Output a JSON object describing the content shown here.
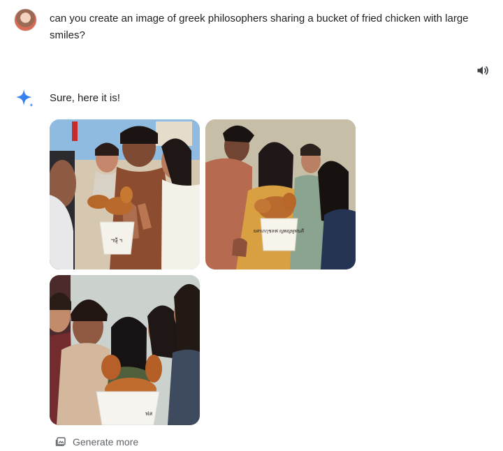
{
  "conversation": {
    "user_prompt": "can you create an image of greek philosophers sharing a bucket of fried chicken with large smiles?",
    "assistant_reply": "Sure, here it is!",
    "generate_more_label": "Generate more"
  },
  "images": [
    {
      "name": "generated-image-1",
      "bucket_text": "ฯษุ้ั ฯ"
    },
    {
      "name": "generated-image-2",
      "bucket_text": "ยศรภกุชลฟ ญพญพูฟนตี"
    },
    {
      "name": "generated-image-3",
      "bucket_text": "ฟส"
    }
  ],
  "colors": {
    "accent": "#4285f4",
    "gray_text": "#5f6368",
    "text": "#1f1f1f"
  },
  "icons": {
    "speaker": "volume-icon",
    "spark": "gemini-sparkle-icon",
    "generate": "image-stack-icon"
  }
}
